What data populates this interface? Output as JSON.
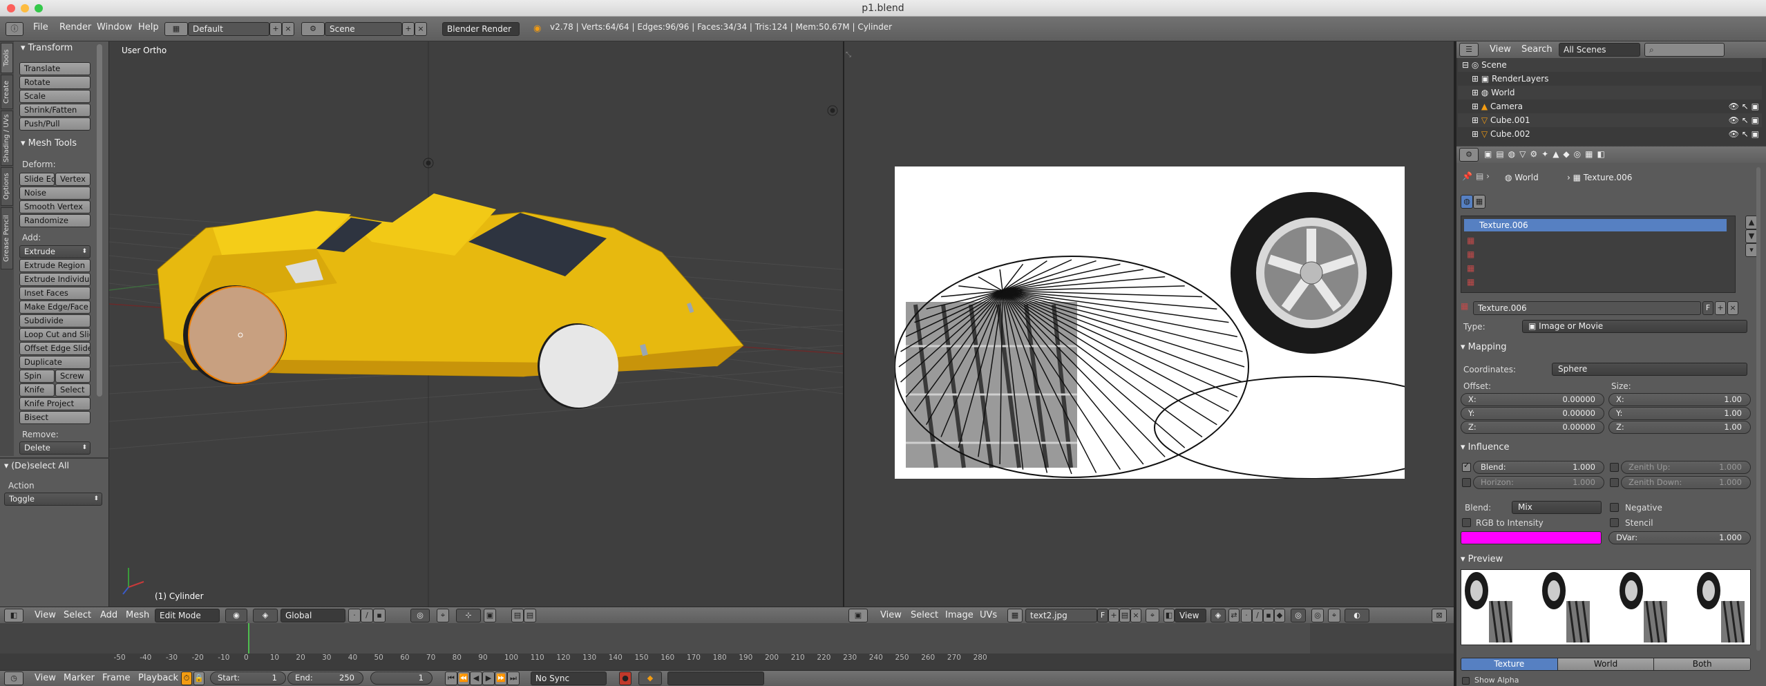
{
  "window": {
    "title": "p1.blend"
  },
  "topbar": {
    "menus": [
      "File",
      "Render",
      "Window",
      "Help"
    ],
    "layout": "Default",
    "scene": "Scene",
    "engine": "Blender Render",
    "stats": "v2.78 | Verts:64/64 | Edges:96/96 | Faces:34/34 | Tris:124 | Mem:50.67M | Cylinder"
  },
  "toolshelf": {
    "tabs": [
      "Tools",
      "Create",
      "Shading / UVs",
      "Options",
      "Grease Pencil"
    ],
    "transform_header": "Transform",
    "transform_buttons": [
      "Translate",
      "Rotate",
      "Scale",
      "Shrink/Fatten",
      "Push/Pull"
    ],
    "mesh_tools_header": "Mesh Tools",
    "deform_label": "Deform:",
    "slide_edge": "Slide Ed",
    "vertex": "Vertex",
    "noise": "Noise",
    "smooth_vertex": "Smooth Vertex",
    "randomize": "Randomize",
    "add_label": "Add:",
    "extrude": "Extrude",
    "add_buttons": [
      "Extrude Region",
      "Extrude Individual",
      "Inset Faces",
      "Make Edge/Face",
      "Subdivide",
      "Loop Cut and Slide",
      "Offset Edge Slide",
      "Duplicate"
    ],
    "spin": "Spin",
    "screw": "Screw",
    "knife": "Knife",
    "select": "Select",
    "knife_project": "Knife Project",
    "bisect": "Bisect",
    "remove_label": "Remove:",
    "delete": "Delete",
    "operator_header": "(De)select All",
    "action_label": "Action",
    "action_value": "Toggle"
  },
  "viewport3d": {
    "view_label": "User Ortho",
    "object_label": "(1) Cylinder",
    "header": {
      "menus": [
        "View",
        "Select",
        "Add",
        "Mesh"
      ],
      "mode": "Edit Mode",
      "orientation": "Global"
    }
  },
  "image_editor": {
    "header": {
      "menus": [
        "View",
        "Select",
        "Image",
        "UVs"
      ],
      "image_name": "text2.jpg",
      "f_label": "F",
      "view": "View"
    }
  },
  "timeline": {
    "ticks": [
      -50,
      -40,
      -30,
      -20,
      -10,
      0,
      10,
      20,
      30,
      40,
      50,
      60,
      70,
      80,
      90,
      100,
      110,
      120,
      130,
      140,
      150,
      160,
      170,
      180,
      190,
      200,
      210,
      220,
      230,
      240,
      250,
      260,
      270,
      280
    ],
    "current_frame": 1,
    "menus": [
      "View",
      "Marker",
      "Frame",
      "Playback"
    ],
    "start": "Start:",
    "start_value": "1",
    "end": "End:",
    "end_value": "250",
    "frame_value": "1",
    "sync": "No Sync"
  },
  "outliner": {
    "menus": [
      "View",
      "Search"
    ],
    "filter": "All Scenes",
    "items": [
      "Scene",
      "RenderLayers",
      "World",
      "Camera",
      "Cube.001",
      "Cube.002"
    ]
  },
  "properties": {
    "breadcrumb_world": "World",
    "breadcrumb_texture": "Texture.006",
    "slots": [
      "Texture.006",
      "",
      "",
      "",
      ""
    ],
    "texture_name": "Texture.006",
    "f_label": "F",
    "type_label": "Type:",
    "type_value": "Image or Movie",
    "mapping_header": "Mapping",
    "coordinates_label": "Coordinates:",
    "coordinates_value": "Sphere",
    "offset_label": "Offset:",
    "size_label": "Size:",
    "offset": [
      {
        "axis": "X:",
        "value": "0.00000"
      },
      {
        "axis": "Y:",
        "value": "0.00000"
      },
      {
        "axis": "Z:",
        "value": "0.00000"
      }
    ],
    "size": [
      {
        "axis": "X:",
        "value": "1.00"
      },
      {
        "axis": "Y:",
        "value": "1.00"
      },
      {
        "axis": "Z:",
        "value": "1.00"
      }
    ],
    "influence_header": "Influence",
    "blend_field": "Blend:",
    "blend_value": "1.000",
    "zenith_up": "Zenith Up:",
    "zenith_up_value": "1.000",
    "horizon": "Horizon:",
    "horizon_value": "1.000",
    "zenith_down": "Zenith Down:",
    "zenith_down_value": "1.000",
    "blend_mode_label": "Blend:",
    "blend_mode_value": "Mix",
    "negative": "Negative",
    "rgb_to_intensity": "RGB to Intensity",
    "stencil": "Stencil",
    "dvar_label": "DVar:",
    "dvar_value": "1.000",
    "color_swatch": "#ff00ff",
    "preview_header": "Preview",
    "preview_tabs": [
      "Texture",
      "World",
      "Both"
    ],
    "show_alpha": "Show Alpha"
  }
}
